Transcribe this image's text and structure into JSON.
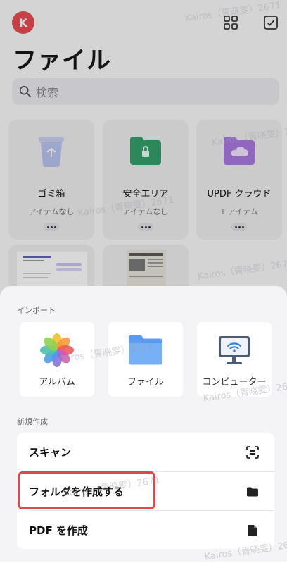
{
  "header": {
    "avatar_initial": "K",
    "title": "ファイル",
    "icons": [
      "grid-icon",
      "select-check-icon"
    ]
  },
  "search": {
    "placeholder": "検索"
  },
  "folders": [
    {
      "name": "ゴミ箱",
      "sub": "アイテムなし",
      "icon": "trash-icon",
      "color": "#b7c2ee"
    },
    {
      "name": "安全エリア",
      "sub": "アイテムなし",
      "icon": "lock-folder-icon",
      "color": "#2e9e64"
    },
    {
      "name": "UPDF クラウド",
      "sub": "1 アイテム",
      "icon": "cloud-folder-icon",
      "color": "#a874e0"
    }
  ],
  "sheet": {
    "import_label": "インポート",
    "import_items": [
      {
        "label": "アルバム",
        "icon": "photos-icon"
      },
      {
        "label": "ファイル",
        "icon": "folder-icon"
      },
      {
        "label": "コンピューター",
        "icon": "computer-wifi-icon"
      }
    ],
    "create_label": "新規作成",
    "create_items": [
      {
        "label": "スキャン",
        "icon": "scan-icon"
      },
      {
        "label": "フォルダを作成する",
        "icon": "folder-small-icon"
      },
      {
        "label": "PDF を作成",
        "icon": "file-icon"
      }
    ]
  },
  "watermark": "Kairos（胥晓雯）2671"
}
